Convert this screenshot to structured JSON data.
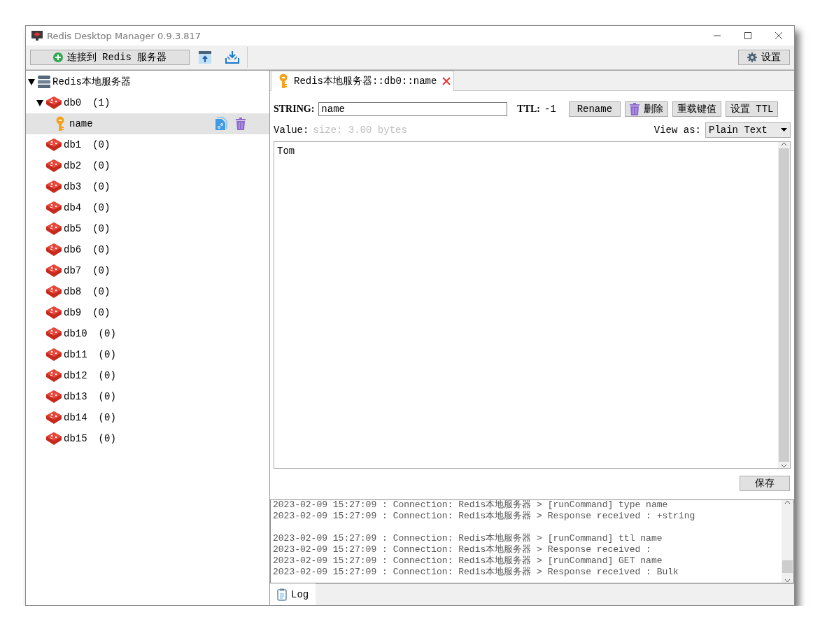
{
  "window": {
    "title": "Redis Desktop Manager 0.9.3.817"
  },
  "toolbar": {
    "connect_button": "连接到 Redis 服务器",
    "settings_button": "设置"
  },
  "tree": {
    "label": "Redis本地服务器",
    "expanded": true,
    "children": [
      {
        "label": "db0",
        "count": "(1)",
        "expanded": true,
        "children": [
          {
            "label": "name",
            "selected": true
          }
        ]
      },
      {
        "label": "db1",
        "count": "(0)"
      },
      {
        "label": "db2",
        "count": "(0)"
      },
      {
        "label": "db3",
        "count": "(0)"
      },
      {
        "label": "db4",
        "count": "(0)"
      },
      {
        "label": "db5",
        "count": "(0)"
      },
      {
        "label": "db6",
        "count": "(0)"
      },
      {
        "label": "db7",
        "count": "(0)"
      },
      {
        "label": "db8",
        "count": "(0)"
      },
      {
        "label": "db9",
        "count": "(0)"
      },
      {
        "label": "db10",
        "count": "(0)"
      },
      {
        "label": "db11",
        "count": "(0)"
      },
      {
        "label": "db12",
        "count": "(0)"
      },
      {
        "label": "db13",
        "count": "(0)"
      },
      {
        "label": "db14",
        "count": "(0)"
      },
      {
        "label": "db15",
        "count": "(0)"
      }
    ]
  },
  "key_tab": {
    "title": "Redis本地服务器::db0::name",
    "selected": true
  },
  "editor": {
    "type_label": "STRING:",
    "key_name": "name",
    "ttl_label": "TTL:",
    "ttl_value": "-1",
    "buttons": [
      {
        "label": "Rename",
        "kind": "plain"
      },
      {
        "label": "删除",
        "kind": "delete"
      },
      {
        "label": "重载键值",
        "kind": "plain"
      },
      {
        "label": "设置 TTL",
        "kind": "plain"
      }
    ],
    "value_label": "Value:",
    "size_hint": "size: 3.00 bytes",
    "view_as_label": "View as:",
    "view_as": "Plain Text",
    "value": "Tom",
    "save_button": "保存"
  },
  "log": {
    "lines": [
      {
        "text": "2023-02-09 15:27:09 : Connection: Redis本地服务器 > [runCommand] type name",
        "blank_before": false
      },
      {
        "text": "2023-02-09 15:27:09 : Connection: Redis本地服务器 > Response received : +string",
        "blank_before": false
      },
      {
        "text": "2023-02-09 15:27:09 : Connection: Redis本地服务器 > [runCommand] ttl name",
        "blank_before": true
      },
      {
        "text": "2023-02-09 15:27:09 : Connection: Redis本地服务器 > Response received :",
        "blank_before": false
      },
      {
        "text": "2023-02-09 15:27:09 : Connection: Redis本地服务器 > [runCommand] GET name",
        "blank_before": false
      },
      {
        "text": "2023-02-09 15:27:09 : Connection: Redis本地服务器 > Response received : Bulk",
        "blank_before": false
      }
    ],
    "tab": {
      "label": "Log",
      "selected": true
    }
  }
}
